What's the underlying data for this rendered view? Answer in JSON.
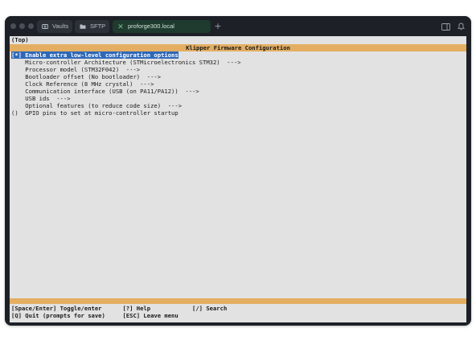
{
  "tabs": [
    {
      "label": "Vaults",
      "icon": "vault-icon"
    },
    {
      "label": "SFTP",
      "icon": "folder-icon"
    },
    {
      "label": "proforge300.local",
      "icon": "close-icon"
    }
  ],
  "terminal": {
    "top_label": "(Top)",
    "title": "Klipper Firmware Configuration",
    "items": [
      "[*] Enable extra low-level configuration options",
      "    Micro-controller Architecture (STMicroelectronics STM32)  --->",
      "    Processor model (STM32F042)  --->",
      "    Bootloader offset (No bootloader)  --->",
      "    Clock Reference (8 MHz crystal)  --->",
      "    Communication interface (USB (on PA11/PA12))  --->",
      "    USB ids  --->",
      "    Optional features (to reduce code size)  --->",
      "()  GPIO pins to set at micro-controller startup"
    ],
    "help_line_1": "[Space/Enter] Toggle/enter      [?] Help            [/] Search",
    "help_line_2": "[Q] Quit (prompts for save)     [ESC] Leave menu"
  },
  "colors": {
    "window_bg": "#1d2127",
    "terminal_bg": "#e2e2e2",
    "title_bar": "#e3ae62",
    "selection": "#2e68b8"
  }
}
